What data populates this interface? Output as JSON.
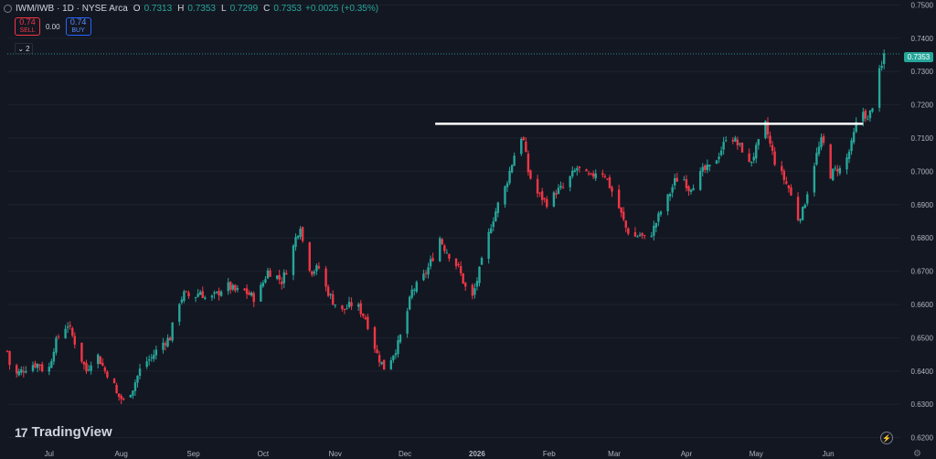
{
  "header": {
    "symbol": "IWM/IWB · 1D · NYSE Arca",
    "o_label": "O",
    "o_value": "0.7313",
    "h_label": "H",
    "h_value": "0.7353",
    "l_label": "L",
    "l_value": "0.7299",
    "c_label": "C",
    "c_value": "0.7353",
    "change": "+0.0025 (+0.35%)"
  },
  "trade": {
    "sell_price": "0.74",
    "sell_label": "SELL",
    "spread": "0.00",
    "buy_price": "0.74",
    "buy_label": "BUY"
  },
  "indicators_toggle": "2",
  "last_price": "0.7353",
  "brand": "TradingView",
  "colors": {
    "up": "#26a69a",
    "down": "#f23645",
    "background": "#131722",
    "grid": "#1e222d",
    "line": "#ffffff"
  },
  "icons": [
    "eye-icon",
    "chevron-down-icon",
    "lightning-icon",
    "gear-icon"
  ],
  "chart_data": {
    "type": "candlestick",
    "symbol": "IWM/IWB",
    "timeframe": "1D",
    "y_ticks": [
      "0.7500",
      "0.7400",
      "0.7300",
      "0.7200",
      "0.7100",
      "0.7000",
      "0.6900",
      "0.6800",
      "0.6700",
      "0.6600",
      "0.6500",
      "0.6400",
      "0.6300",
      "0.6200"
    ],
    "ylim": [
      0.6185,
      0.7515
    ],
    "x_ticks": [
      {
        "label": "Jul",
        "d": 0
      },
      {
        "label": "Aug",
        "d": 31
      },
      {
        "label": "Sep",
        "d": 62
      },
      {
        "label": "Oct",
        "d": 92
      },
      {
        "label": "Nov",
        "d": 123
      },
      {
        "label": "Dec",
        "d": 153
      },
      {
        "label": "2026",
        "d": 184
      },
      {
        "label": "Feb",
        "d": 215
      },
      {
        "label": "Mar",
        "d": 243
      },
      {
        "label": "Apr",
        "d": 274
      },
      {
        "label": "May",
        "d": 304
      },
      {
        "label": "Jun",
        "d": 335
      }
    ],
    "xlim": [
      -18,
      366
    ],
    "horizontal_line": 0.7143,
    "horizontal_line_range": [
      166,
      350
    ],
    "anchors": [
      [
        -18,
        0.646
      ],
      [
        -16,
        0.638
      ],
      [
        -12,
        0.64
      ],
      [
        -8,
        0.642
      ],
      [
        -4,
        0.642
      ],
      [
        -1,
        0.638
      ],
      [
        2,
        0.647
      ],
      [
        5,
        0.652
      ],
      [
        8,
        0.654
      ],
      [
        12,
        0.647
      ],
      [
        16,
        0.64
      ],
      [
        20,
        0.646
      ],
      [
        24,
        0.64
      ],
      [
        27,
        0.638
      ],
      [
        29,
        0.633
      ],
      [
        32,
        0.631
      ],
      [
        36,
        0.635
      ],
      [
        40,
        0.642
      ],
      [
        44,
        0.644
      ],
      [
        48,
        0.648
      ],
      [
        52,
        0.65
      ],
      [
        55,
        0.66
      ],
      [
        58,
        0.663
      ],
      [
        62,
        0.662
      ],
      [
        65,
        0.664
      ],
      [
        68,
        0.661
      ],
      [
        72,
        0.663
      ],
      [
        76,
        0.666
      ],
      [
        80,
        0.664
      ],
      [
        84,
        0.664
      ],
      [
        88,
        0.662
      ],
      [
        91,
        0.665
      ],
      [
        94,
        0.67
      ],
      [
        97,
        0.669
      ],
      [
        100,
        0.667
      ],
      [
        103,
        0.672
      ],
      [
        106,
        0.68
      ],
      [
        108,
        0.684
      ],
      [
        110,
        0.674
      ],
      [
        113,
        0.67
      ],
      [
        116,
        0.671
      ],
      [
        119,
        0.665
      ],
      [
        122,
        0.661
      ],
      [
        126,
        0.658
      ],
      [
        130,
        0.66
      ],
      [
        133,
        0.659
      ],
      [
        136,
        0.656
      ],
      [
        138,
        0.652
      ],
      [
        141,
        0.645
      ],
      [
        144,
        0.641
      ],
      [
        147,
        0.644
      ],
      [
        150,
        0.648
      ],
      [
        153,
        0.655
      ],
      [
        156,
        0.664
      ],
      [
        160,
        0.667
      ],
      [
        163,
        0.671
      ],
      [
        166,
        0.676
      ],
      [
        168,
        0.68
      ],
      [
        170,
        0.677
      ],
      [
        173,
        0.674
      ],
      [
        176,
        0.671
      ],
      [
        179,
        0.665
      ],
      [
        182,
        0.662
      ],
      [
        185,
        0.67
      ],
      [
        188,
        0.678
      ],
      [
        190,
        0.684
      ],
      [
        193,
        0.69
      ],
      [
        196,
        0.695
      ],
      [
        198,
        0.7
      ],
      [
        200,
        0.705
      ],
      [
        202,
        0.712
      ],
      [
        204,
        0.709
      ],
      [
        206,
        0.7
      ],
      [
        209,
        0.694
      ],
      [
        212,
        0.692
      ],
      [
        215,
        0.69
      ],
      [
        218,
        0.694
      ],
      [
        221,
        0.695
      ],
      [
        224,
        0.698
      ],
      [
        227,
        0.701
      ],
      [
        230,
        0.699
      ],
      [
        233,
        0.698
      ],
      [
        236,
        0.701
      ],
      [
        239,
        0.699
      ],
      [
        242,
        0.694
      ],
      [
        245,
        0.689
      ],
      [
        248,
        0.683
      ],
      [
        251,
        0.68
      ],
      [
        254,
        0.681
      ],
      [
        257,
        0.679
      ],
      [
        260,
        0.683
      ],
      [
        263,
        0.688
      ],
      [
        266,
        0.692
      ],
      [
        269,
        0.697
      ],
      [
        272,
        0.699
      ],
      [
        275,
        0.695
      ],
      [
        278,
        0.697
      ],
      [
        281,
        0.7
      ],
      [
        284,
        0.701
      ],
      [
        287,
        0.704
      ],
      [
        290,
        0.708
      ],
      [
        292,
        0.713
      ],
      [
        294,
        0.71
      ],
      [
        296,
        0.708
      ],
      [
        299,
        0.706
      ],
      [
        301,
        0.702
      ],
      [
        303,
        0.705
      ],
      [
        306,
        0.71
      ],
      [
        308,
        0.714
      ],
      [
        310,
        0.708
      ],
      [
        312,
        0.703
      ],
      [
        315,
        0.699
      ],
      [
        318,
        0.695
      ],
      [
        320,
        0.69
      ],
      [
        322,
        0.686
      ],
      [
        324,
        0.688
      ],
      [
        326,
        0.694
      ],
      [
        328,
        0.7
      ],
      [
        330,
        0.705
      ],
      [
        332,
        0.709
      ],
      [
        334,
        0.707
      ],
      [
        336,
        0.699
      ],
      [
        339,
        0.701
      ],
      [
        341,
        0.7
      ],
      [
        343,
        0.704
      ],
      [
        345,
        0.708
      ],
      [
        347,
        0.714
      ],
      [
        349,
        0.719
      ],
      [
        351,
        0.717
      ],
      [
        352,
        0.715
      ],
      [
        354,
        0.72
      ],
      [
        356,
        0.728
      ],
      [
        358,
        0.7313
      ],
      [
        359,
        0.7353
      ]
    ]
  }
}
